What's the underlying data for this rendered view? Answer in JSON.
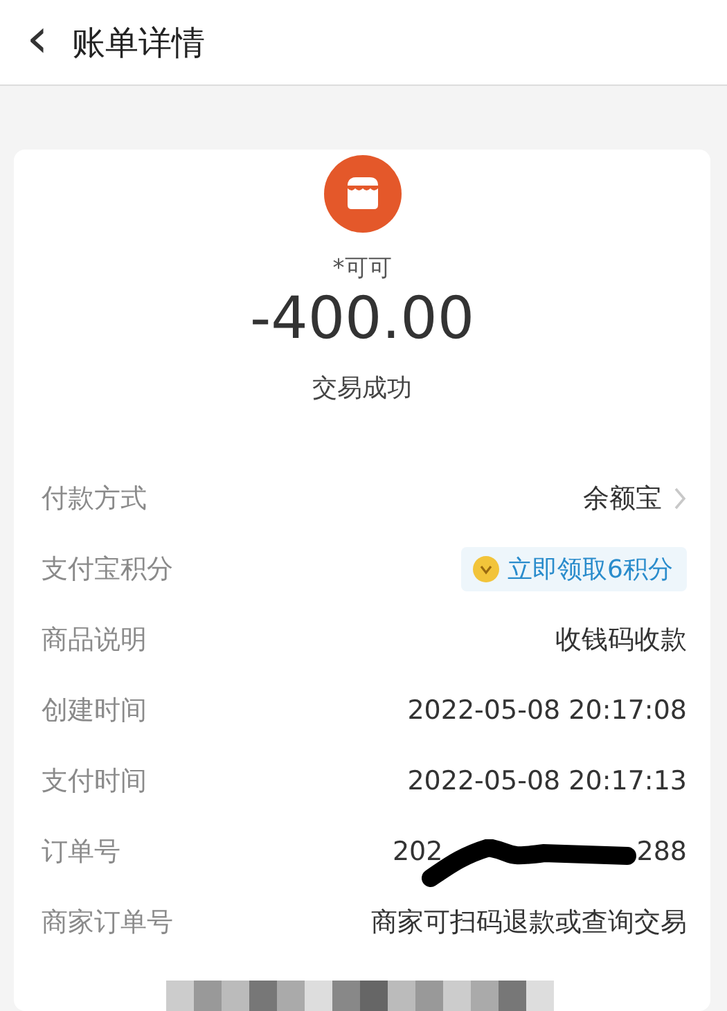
{
  "header": {
    "back_icon": "‹",
    "title": "账单详情"
  },
  "summary": {
    "payee": "*可可",
    "amount": "-400.00",
    "status": "交易成功"
  },
  "rows": [
    {
      "kind": "chevron",
      "label": "付款方式",
      "value": "余额宝"
    },
    {
      "kind": "points",
      "label": "支付宝积分",
      "value": "立即领取6积分"
    },
    {
      "kind": "plain",
      "label": "商品说明",
      "value": "收钱码收款"
    },
    {
      "kind": "plain",
      "label": "创建时间",
      "value": "2022-05-08 20:17:08"
    },
    {
      "kind": "plain",
      "label": "支付时间",
      "value": "2022-05-08 20:17:13"
    },
    {
      "kind": "redacted",
      "label": "订单号",
      "value_start": "202",
      "value_end": "288"
    },
    {
      "kind": "plain",
      "label": "商家订单号",
      "value": "商家可扫码退款或查询交易"
    }
  ]
}
